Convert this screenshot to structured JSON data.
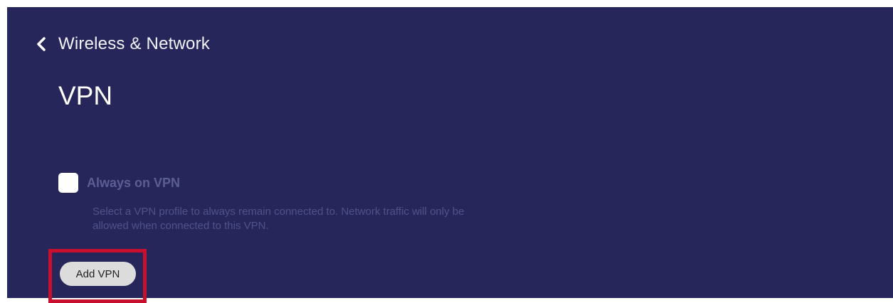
{
  "header": {
    "back_icon": "chevron-left-icon",
    "breadcrumb": "Wireless & Network"
  },
  "page": {
    "title": "VPN"
  },
  "always_on": {
    "label": "Always on VPN",
    "checked": false,
    "description": "Select a VPN profile to always remain connected to. Network traffic will only be allowed when connected to this VPN."
  },
  "actions": {
    "add_vpn_label": "Add VPN"
  },
  "colors": {
    "background": "#26265a",
    "highlight": "#c8102e",
    "button": "#dcdcdc"
  }
}
